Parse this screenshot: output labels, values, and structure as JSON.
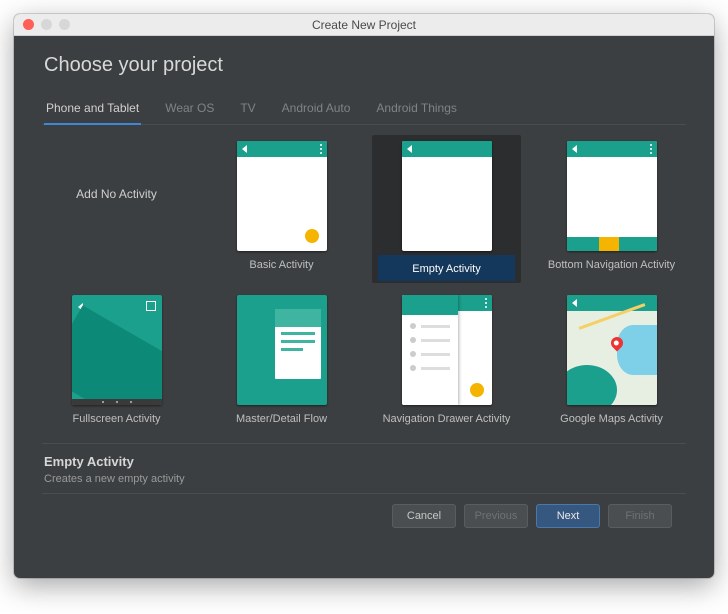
{
  "window": {
    "title": "Create New Project"
  },
  "heading": "Choose your project",
  "tabs": [
    {
      "label": "Phone and Tablet",
      "active": true
    },
    {
      "label": "Wear OS"
    },
    {
      "label": "TV"
    },
    {
      "label": "Android Auto"
    },
    {
      "label": "Android Things"
    }
  ],
  "templates": [
    {
      "label": "Add No Activity",
      "kind": "none"
    },
    {
      "label": "Basic Activity",
      "kind": "basic"
    },
    {
      "label": "Empty Activity",
      "kind": "empty",
      "selected": true
    },
    {
      "label": "Bottom Navigation Activity",
      "kind": "bottomnav"
    },
    {
      "label": "Fullscreen Activity",
      "kind": "fullscreen"
    },
    {
      "label": "Master/Detail Flow",
      "kind": "master"
    },
    {
      "label": "Navigation Drawer Activity",
      "kind": "navdrawer"
    },
    {
      "label": "Google Maps Activity",
      "kind": "maps"
    }
  ],
  "description": {
    "title": "Empty Activity",
    "subtitle": "Creates a new empty activity"
  },
  "buttons": {
    "cancel": "Cancel",
    "previous": "Previous",
    "next": "Next",
    "finish": "Finish"
  },
  "colors": {
    "accent": "#1aa08c",
    "fab": "#f5b400",
    "primary_btn": "#365880"
  }
}
